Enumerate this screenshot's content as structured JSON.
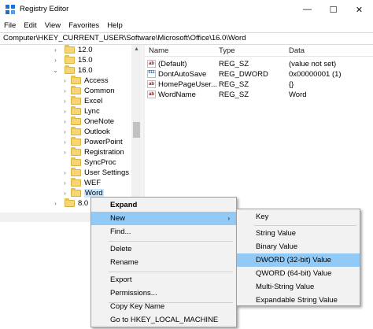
{
  "window": {
    "title": "Registry Editor",
    "minimize_glyph": "—",
    "maximize_glyph": "☐",
    "close_glyph": "✕"
  },
  "menubar": [
    "File",
    "Edit",
    "View",
    "Favorites",
    "Help"
  ],
  "address": "Computer\\HKEY_CURRENT_USER\\Software\\Microsoft\\Office\\16.0\\Word",
  "tree": {
    "items": [
      {
        "label": "12.0",
        "chevron": "›"
      },
      {
        "label": "15.0",
        "chevron": "›"
      },
      {
        "label": "16.0",
        "chevron": "⌄"
      },
      {
        "label": "Access",
        "chevron": "›"
      },
      {
        "label": "Common",
        "chevron": "›"
      },
      {
        "label": "Excel",
        "chevron": "›"
      },
      {
        "label": "Lync",
        "chevron": "›"
      },
      {
        "label": "OneNote",
        "chevron": "›"
      },
      {
        "label": "Outlook",
        "chevron": "›"
      },
      {
        "label": "PowerPoint",
        "chevron": "›"
      },
      {
        "label": "Registration",
        "chevron": "›"
      },
      {
        "label": "SyncProc",
        "chevron": ""
      },
      {
        "label": "User Settings",
        "chevron": "›"
      },
      {
        "label": "WEF",
        "chevron": "›"
      },
      {
        "label": "Word",
        "chevron": "›"
      },
      {
        "label": "8.0",
        "chevron": "›"
      }
    ]
  },
  "list": {
    "headers": [
      "Name",
      "Type",
      "Data"
    ],
    "rows": [
      {
        "icon": "ab",
        "name": "(Default)",
        "type": "REG_SZ",
        "data": "(value not set)"
      },
      {
        "icon": "011",
        "name": "DontAutoSave",
        "type": "REG_DWORD",
        "data": "0x00000001 (1)"
      },
      {
        "icon": "ab",
        "name": "HomePageUser...",
        "type": "REG_SZ",
        "data": "{}"
      },
      {
        "icon": "ab",
        "name": "WordName",
        "type": "REG_SZ",
        "data": "Word"
      }
    ]
  },
  "context_menu": {
    "items": [
      {
        "label": "Expand",
        "bold": true
      },
      {
        "label": "New",
        "submenu": true,
        "highlighted": true
      },
      {
        "label": "Find..."
      },
      {
        "sep": true
      },
      {
        "label": "Delete"
      },
      {
        "label": "Rename"
      },
      {
        "sep": true
      },
      {
        "label": "Export"
      },
      {
        "label": "Permissions..."
      },
      {
        "sep": true
      },
      {
        "label": "Copy Key Name"
      },
      {
        "label": "Go to HKEY_LOCAL_MACHINE"
      }
    ],
    "submenu_arrow": "›"
  },
  "new_submenu": {
    "items": [
      {
        "label": "Key"
      },
      {
        "sep": true
      },
      {
        "label": "String Value"
      },
      {
        "label": "Binary Value"
      },
      {
        "label": "DWORD (32-bit) Value",
        "highlighted": true
      },
      {
        "label": "QWORD (64-bit) Value"
      },
      {
        "label": "Multi-String Value"
      },
      {
        "label": "Expandable String Value"
      }
    ]
  },
  "colors": {
    "highlight": "#91c9f7",
    "selection": "#cce8ff",
    "folder": "#f5d574"
  }
}
